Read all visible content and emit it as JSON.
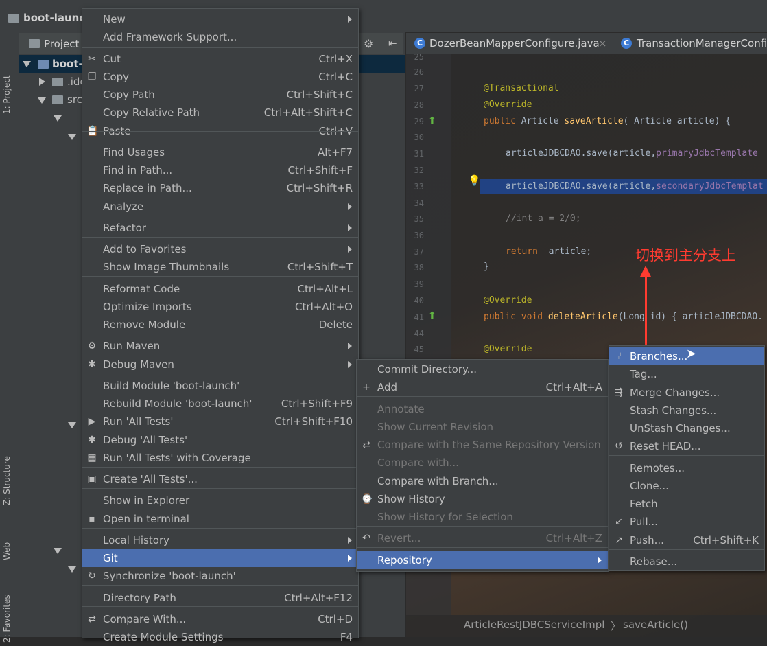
{
  "navbar": {
    "root": "boot-launc"
  },
  "left_strip": {
    "project_tab": "1: Project",
    "structure_tab": "Z: Structure",
    "web_tab": "Web",
    "favorites_tab": "2: Favorites"
  },
  "project_panel": {
    "title": "Project",
    "root_node": "boot-",
    "nodes": [
      ".ide",
      "src"
    ]
  },
  "editor": {
    "tabs": [
      "DozerBeanMapperConfigure.java",
      "TransactionManagerConfig"
    ],
    "line_numbers": [
      "25",
      "26",
      "27",
      "28",
      "29",
      "30",
      "31",
      "32",
      "33",
      "34",
      "35",
      "36",
      "37",
      "38",
      "39",
      "40",
      "41",
      "44",
      "45"
    ],
    "code": {
      "l27": "@Transactional",
      "l28": "@Override",
      "l29a": "public ",
      "l29b": "Article ",
      "l29c": "saveArticle",
      "l29d": "( Article article) {",
      "l31a": "articleJDBCDAO.save(article,",
      "l31b": "primaryJdbcTemplate",
      "l33a": "articleJDBCDAO.save(article,",
      "l33b": "secondaryJdbcTemplat",
      "l35": "//int a = 2/0;",
      "l37a": "return ",
      "l37b": " article;",
      "l38": "}",
      "l40": "@Override",
      "l41a": "public void ",
      "l41b": "deleteArticle",
      "l41c": "(Long id) { articleJDBCDAO.",
      "l45": "@Override"
    },
    "annotation": "切换到主分支上",
    "breadcrumb": {
      "class": "ArticleRestJDBCServiceImpl",
      "method": "saveArticle()"
    }
  },
  "context_menu": {
    "items": [
      {
        "label": "New",
        "shortcut": "",
        "sub": true
      },
      {
        "label": "Add Framework Support...",
        "shortcut": "",
        "sub": false
      },
      {
        "label": "Cut",
        "shortcut": "Ctrl+X",
        "sub": false,
        "icon": "✂"
      },
      {
        "label": "Copy",
        "shortcut": "Ctrl+C",
        "sub": false,
        "icon": "❐"
      },
      {
        "label": "Copy Path",
        "shortcut": "Ctrl+Shift+C",
        "sub": false
      },
      {
        "label": "Copy Relative Path",
        "shortcut": "Ctrl+Alt+Shift+C",
        "sub": false
      },
      {
        "label": "Paste",
        "shortcut": "Ctrl+V",
        "sub": false,
        "icon": "📋"
      },
      {
        "label": "Find Usages",
        "shortcut": "Alt+F7",
        "sub": false
      },
      {
        "label": "Find in Path...",
        "shortcut": "Ctrl+Shift+F",
        "sub": false
      },
      {
        "label": "Replace in Path...",
        "shortcut": "Ctrl+Shift+R",
        "sub": false
      },
      {
        "label": "Analyze",
        "shortcut": "",
        "sub": true
      },
      {
        "label": "Refactor",
        "shortcut": "",
        "sub": true
      },
      {
        "label": "Add to Favorites",
        "shortcut": "",
        "sub": true
      },
      {
        "label": "Show Image Thumbnails",
        "shortcut": "Ctrl+Shift+T",
        "sub": false
      },
      {
        "label": "Reformat Code",
        "shortcut": "Ctrl+Alt+L",
        "sub": false
      },
      {
        "label": "Optimize Imports",
        "shortcut": "Ctrl+Alt+O",
        "sub": false
      },
      {
        "label": "Remove Module",
        "shortcut": "Delete",
        "sub": false
      },
      {
        "label": "Run Maven",
        "shortcut": "",
        "sub": true,
        "icon": "⚙"
      },
      {
        "label": "Debug Maven",
        "shortcut": "",
        "sub": true,
        "icon": "✱"
      },
      {
        "label": "Build Module 'boot-launch'",
        "shortcut": "",
        "sub": false
      },
      {
        "label": "Rebuild Module 'boot-launch'",
        "shortcut": "Ctrl+Shift+F9",
        "sub": false
      },
      {
        "label": "Run 'All Tests'",
        "shortcut": "Ctrl+Shift+F10",
        "sub": false,
        "icon": "▶"
      },
      {
        "label": "Debug 'All Tests'",
        "shortcut": "",
        "sub": false,
        "icon": "✱"
      },
      {
        "label": "Run 'All Tests' with Coverage",
        "shortcut": "",
        "sub": false,
        "icon": "▦"
      },
      {
        "label": "Create 'All Tests'...",
        "shortcut": "",
        "sub": false,
        "icon": "▣"
      },
      {
        "label": "Show in Explorer",
        "shortcut": "",
        "sub": false
      },
      {
        "label": "Open in terminal",
        "shortcut": "",
        "sub": false,
        "icon": "▪"
      },
      {
        "label": "Local History",
        "shortcut": "",
        "sub": true
      },
      {
        "label": "Git",
        "shortcut": "",
        "sub": true
      },
      {
        "label": "Synchronize 'boot-launch'",
        "shortcut": "",
        "sub": false,
        "icon": "↻"
      },
      {
        "label": "Directory Path",
        "shortcut": "Ctrl+Alt+F12",
        "sub": false
      },
      {
        "label": "Compare With...",
        "shortcut": "Ctrl+D",
        "sub": false,
        "icon": "⇄"
      },
      {
        "label": "Create Module Settings",
        "shortcut": "F4",
        "sub": false
      }
    ]
  },
  "git_menu": {
    "items": [
      {
        "label": "Commit Directory...",
        "shortcut": ""
      },
      {
        "label": "Add",
        "shortcut": "Ctrl+Alt+A",
        "icon": "+"
      },
      {
        "label": "Annotate",
        "shortcut": ""
      },
      {
        "label": "Show Current Revision",
        "shortcut": ""
      },
      {
        "label": "Compare with the Same Repository Version",
        "shortcut": "",
        "icon": "⇄"
      },
      {
        "label": "Compare with...",
        "shortcut": ""
      },
      {
        "label": "Compare with Branch...",
        "shortcut": ""
      },
      {
        "label": "Show History",
        "shortcut": "",
        "icon": "⌚"
      },
      {
        "label": "Show History for Selection",
        "shortcut": ""
      },
      {
        "label": "Revert...",
        "shortcut": "Ctrl+Alt+Z",
        "icon": "↶"
      },
      {
        "label": "Repository",
        "shortcut": ""
      }
    ]
  },
  "repo_menu": {
    "items": [
      {
        "label": "Branches...",
        "shortcut": "",
        "icon": "⑂"
      },
      {
        "label": "Tag...",
        "shortcut": ""
      },
      {
        "label": "Merge Changes...",
        "shortcut": "",
        "icon": "⇶"
      },
      {
        "label": "Stash Changes...",
        "shortcut": ""
      },
      {
        "label": "UnStash Changes...",
        "shortcut": ""
      },
      {
        "label": "Reset HEAD...",
        "shortcut": "",
        "icon": "↺"
      },
      {
        "label": "Remotes...",
        "shortcut": ""
      },
      {
        "label": "Clone...",
        "shortcut": ""
      },
      {
        "label": "Fetch",
        "shortcut": ""
      },
      {
        "label": "Pull...",
        "shortcut": "",
        "icon": "↙"
      },
      {
        "label": "Push...",
        "shortcut": "Ctrl+Shift+K",
        "icon": "↗"
      },
      {
        "label": "Rebase...",
        "shortcut": ""
      }
    ]
  }
}
